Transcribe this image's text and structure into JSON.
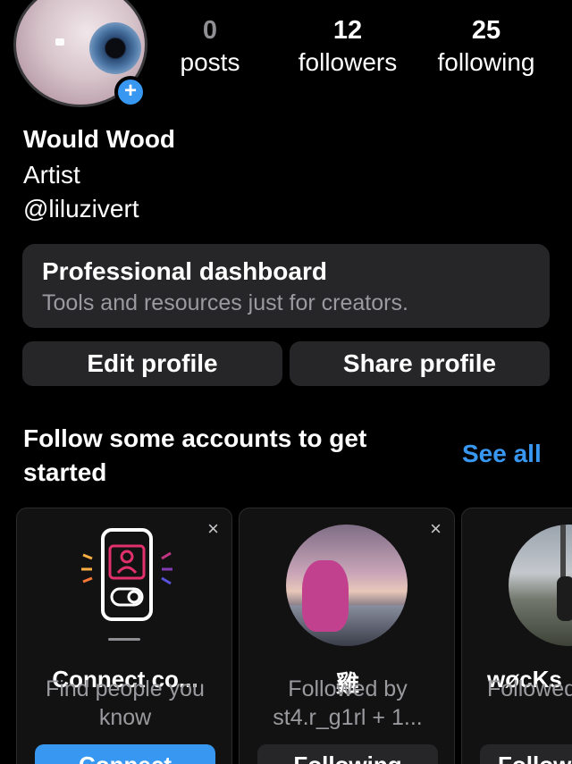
{
  "profile": {
    "name": "Would Wood",
    "category": "Artist",
    "handle": "@liluzivert",
    "stats": {
      "posts": {
        "count": "0",
        "label": "posts"
      },
      "followers": {
        "count": "12",
        "label": "followers"
      },
      "following": {
        "count": "25",
        "label": "following"
      }
    }
  },
  "dashboard": {
    "title": "Professional dashboard",
    "subtitle": "Tools and resources just for creators."
  },
  "actions": {
    "edit": "Edit profile",
    "share": "Share profile"
  },
  "suggestions": {
    "title": "Follow some accounts to get started",
    "see_all": "See all",
    "cards": [
      {
        "name": "Connect co...",
        "sub": "Find people you know",
        "button": "Connect",
        "close": "×"
      },
      {
        "name": "雞",
        "sub": "Followed by st4.r_g1rl + 1...",
        "button": "Following",
        "close": "×"
      },
      {
        "name": "wøcKs",
        "sub": "Followed by shxwity.",
        "button": "Follow"
      }
    ]
  },
  "colors": {
    "accent": "#3897f0",
    "background": "#000000",
    "surface": "#262628",
    "muted_text": "#9a9a9f"
  }
}
